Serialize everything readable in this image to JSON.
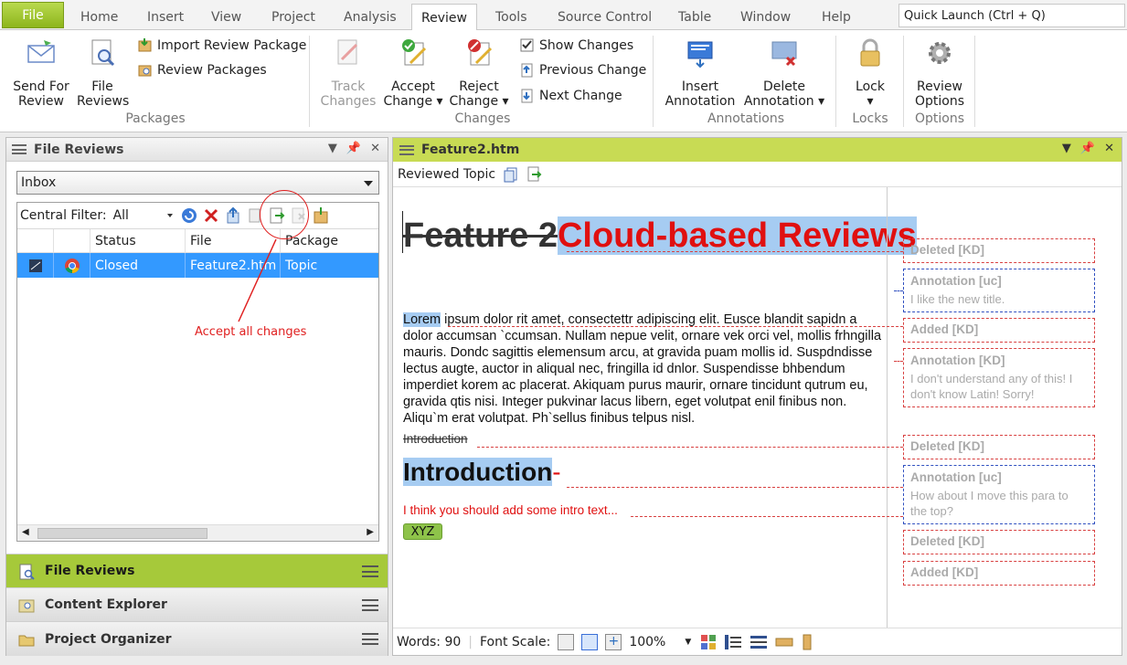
{
  "ribbon_tabs": [
    "File",
    "Home",
    "Insert",
    "View",
    "Project",
    "Analysis",
    "Review",
    "Tools",
    "Source Control",
    "Table",
    "Window",
    "Help"
  ],
  "active_tab": "Review",
  "quick_launch": "Quick Launch (Ctrl + Q)",
  "ribbon": {
    "send_for_review": "Send For\nReview",
    "file_reviews": "File\nReviews",
    "import_review_package": "Import Review Package",
    "review_packages": "Review Packages",
    "group_packages": "Packages",
    "track_changes": "Track\nChanges",
    "accept_change": "Accept\nChange ▾",
    "reject_change": "Reject\nChange ▾",
    "show_changes": "Show Changes",
    "previous_change": "Previous Change",
    "next_change": "Next Change",
    "group_changes": "Changes",
    "insert_annotation": "Insert\nAnnotation",
    "delete_annotation": "Delete\nAnnotation ▾",
    "group_annotations": "Annotations",
    "lock": "Lock\n▾",
    "group_locks": "Locks",
    "review_options": "Review\nOptions",
    "group_options": "Options"
  },
  "left_panel": {
    "title": "File Reviews",
    "inbox": "Inbox",
    "central_filter_label": "Central Filter:",
    "central_filter_value": "All",
    "columns": [
      "Status",
      "File",
      "Package"
    ],
    "rows": [
      {
        "status": "Closed",
        "file": "Feature2.htm",
        "package": "Topic"
      }
    ],
    "callout": "Accept all changes"
  },
  "nav_items": [
    "File Reviews",
    "Content Explorer",
    "Project Organizer"
  ],
  "editor": {
    "tab_title": "Feature2.htm",
    "sub_label": "Reviewed Topic",
    "heading_deleted": "Feature 2",
    "heading_added": "Cloud-based Reviews",
    "para_first": "Lorem",
    "para_rest": " ipsum dolor rit amet, consectettr adipiscing elit. Eusce blandit sapidn a dolor accumsan `ccumsan. Nullam nepue velit, ornare vek orci vel, mollis frhngilla mauris. Dondc sagittis elemensum arcu, at gravida puam mollis id. Suspdndisse lectus augte, auctor in aliqual nec, fringilla id dnlor. Suspendisse bhbendum imperdiet korem ac placerat. Akiquam purus maurir, ornare tincidunt qutrum eu, gravida qtis nisi. Integer pukvinar lacus libern, eget volutpat enil finibus non. Aliqu`m erat volutpat. Ph`sellus finibus telpus nisl.",
    "intro_deleted": "Introduction",
    "heading2": "Introduction",
    "red_text": "I think you should add some intro text...",
    "tag": "XYZ",
    "balloons": [
      {
        "title": "Deleted [KD]",
        "comment": ""
      },
      {
        "title": "Annotation [uc]",
        "comment": "I like the new title."
      },
      {
        "title": "Added [KD]",
        "comment": ""
      },
      {
        "title": "Annotation [KD]",
        "comment": "I don't understand any of this! I don't know Latin! Sorry!"
      },
      {
        "title": "Deleted [KD]",
        "comment": ""
      },
      {
        "title": "Annotation [uc]",
        "comment": "How about I move this para to the top?"
      },
      {
        "title": "Deleted [KD]",
        "comment": ""
      },
      {
        "title": "Added [KD]",
        "comment": ""
      }
    ],
    "status_words": "Words: 90",
    "status_font_scale": "Font Scale:",
    "zoom": "100%"
  }
}
